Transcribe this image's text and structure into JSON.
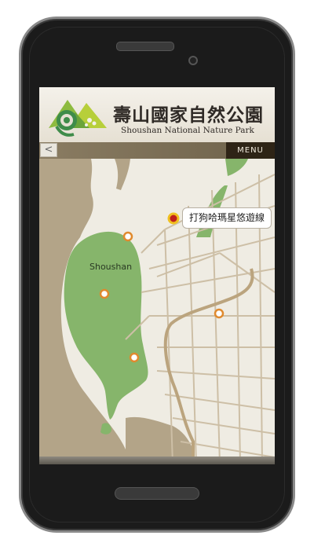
{
  "header": {
    "title": "壽山國家自然公園",
    "subtitle": "Shoushan National Nature Park"
  },
  "nav": {
    "back_icon": "chevron-left-icon",
    "back_glyph": "<",
    "menu_label": "MENU"
  },
  "map": {
    "area_label": "Shoushan",
    "selected_marker_label": "打狗哈瑪星悠遊線",
    "colors": {
      "land": "#efece3",
      "park": "#86b56b",
      "sea": "#b3a488",
      "road": "#cdbfa6",
      "river": "#bba47e",
      "marker": "#e08a2e",
      "marker_selected": "#c0201a"
    }
  }
}
